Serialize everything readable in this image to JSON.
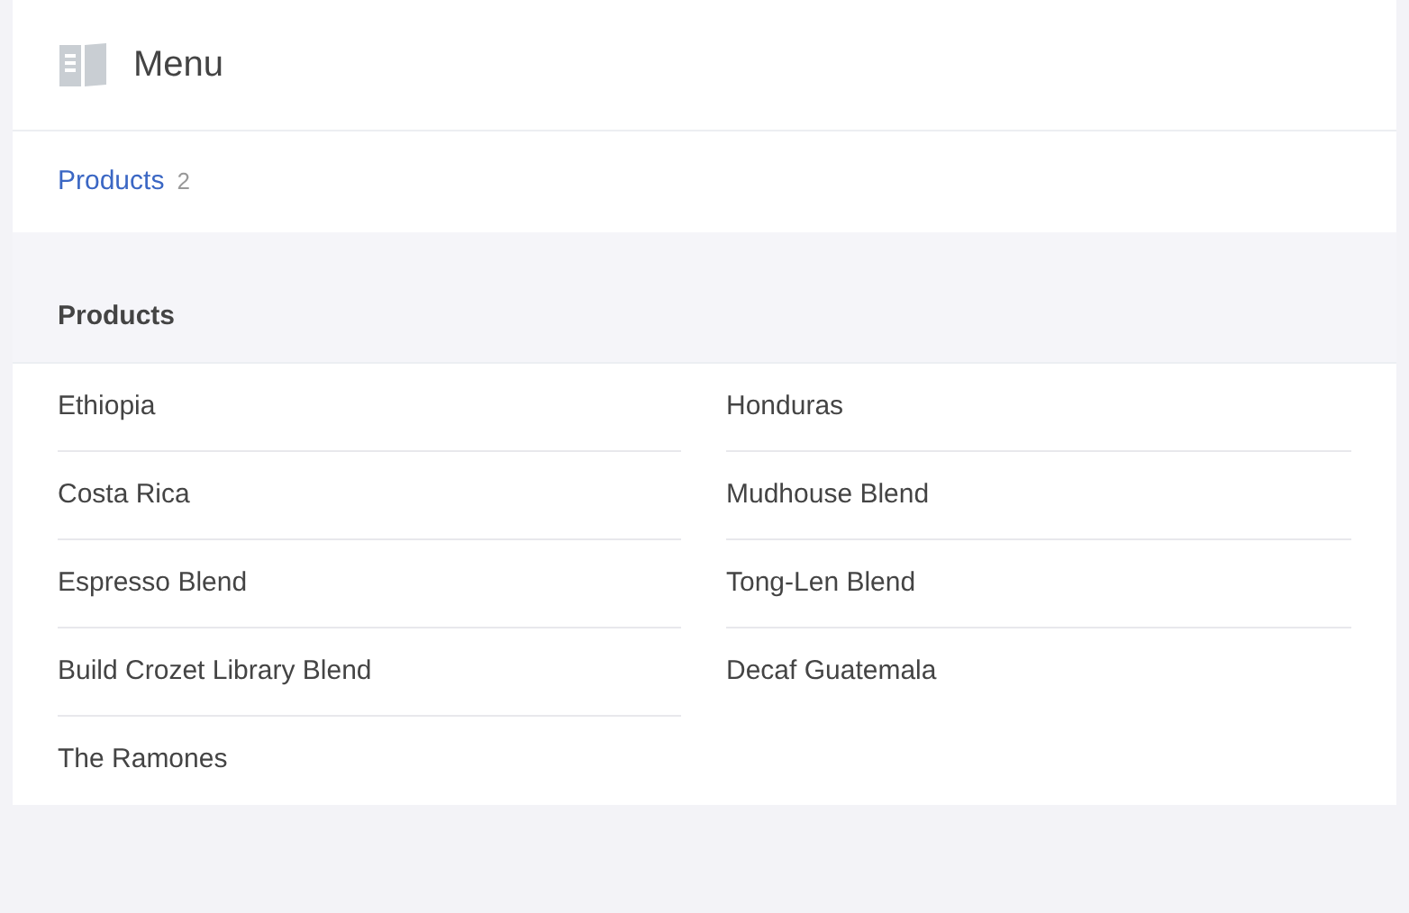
{
  "header": {
    "title": "Menu"
  },
  "nav": [
    {
      "label": "Products",
      "count": "2"
    }
  ],
  "section": {
    "title": "Products",
    "items": [
      "Ethiopia",
      "Honduras",
      "Costa Rica",
      "Mudhouse Blend",
      "Espresso Blend",
      "Tong-Len Blend",
      "Build Crozet Library Blend",
      "Decaf Guatemala",
      "The Ramones"
    ]
  }
}
